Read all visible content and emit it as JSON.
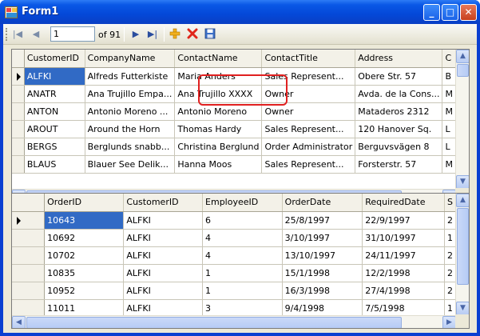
{
  "window": {
    "title": "Form1",
    "minimize_glyph": "_",
    "maximize_glyph": "□",
    "close_glyph": "✕"
  },
  "navigator": {
    "move_first": "|◀",
    "move_previous": "◀",
    "position_value": "1",
    "count_label": "of 91",
    "move_next": "▶",
    "move_last": "▶|",
    "add_icon": "plus-icon",
    "delete_icon": "delete-x-icon",
    "save_icon": "save-disk-icon"
  },
  "customers": {
    "columns": [
      "CustomerID",
      "CompanyName",
      "ContactName",
      "ContactTitle",
      "Address",
      "C"
    ],
    "rows": [
      [
        "ALFKI",
        "Alfreds Futterkiste",
        "Maria Anders",
        "Sales Represent...",
        "Obere Str. 57",
        "B"
      ],
      [
        "ANATR",
        "Ana Trujillo Empa...",
        "Ana Trujillo XXXX",
        "Owner",
        "Avda. de la Cons...",
        "M"
      ],
      [
        "ANTON",
        "Antonio Moreno ...",
        "Antonio Moreno",
        "Owner",
        "Mataderos  2312",
        "M"
      ],
      [
        "AROUT",
        "Around the Horn",
        "Thomas Hardy",
        "Sales Represent...",
        "120 Hanover Sq.",
        "L"
      ],
      [
        "BERGS",
        "Berglunds snabb...",
        "Christina Berglund",
        "Order Administrator",
        "Berguvsvägen  8",
        "L"
      ],
      [
        "BLAUS",
        "Blauer See Delik...",
        "Hanna Moos",
        "Sales Represent...",
        "Forsterstr. 57",
        "M"
      ]
    ]
  },
  "orders": {
    "columns": [
      "OrderID",
      "CustomerID",
      "EmployeeID",
      "OrderDate",
      "RequiredDate",
      "S"
    ],
    "rows": [
      [
        "10643",
        "ALFKI",
        "6",
        "25/8/1997",
        "22/9/1997",
        "2"
      ],
      [
        "10692",
        "ALFKI",
        "4",
        "3/10/1997",
        "31/10/1997",
        "1"
      ],
      [
        "10702",
        "ALFKI",
        "4",
        "13/10/1997",
        "24/11/1997",
        "2"
      ],
      [
        "10835",
        "ALFKI",
        "1",
        "15/1/1998",
        "12/2/1998",
        "2"
      ],
      [
        "10952",
        "ALFKI",
        "1",
        "16/3/1998",
        "27/4/1998",
        "2"
      ],
      [
        "11011",
        "ALFKI",
        "3",
        "9/4/1998",
        "7/5/1998",
        "1"
      ]
    ]
  }
}
